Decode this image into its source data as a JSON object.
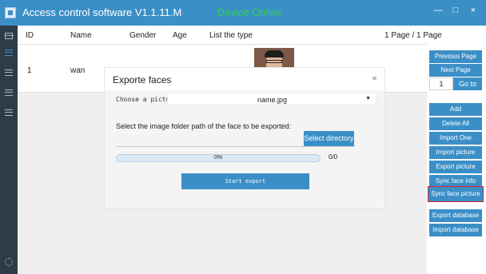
{
  "window": {
    "title": "Access control software V1.1.11.M",
    "device_status": "Device Online",
    "minimize": "—",
    "maximize": "□",
    "close": "×"
  },
  "sidebar": {
    "icons": [
      "list-icon",
      "menu-icon",
      "menu-icon",
      "menu-icon",
      "menu-icon"
    ],
    "settings_icon": "gear-icon"
  },
  "table": {
    "columns": [
      "ID",
      "Name",
      "Gender",
      "Age",
      "List the type"
    ],
    "page_info": "1 Page / 1 Page",
    "rows": [
      {
        "id": "1",
        "name": "wan"
      }
    ]
  },
  "right_panel": {
    "previous_page": "Previous Page",
    "next_page": "Next Page",
    "page_input": "1",
    "go_to": "Go to",
    "add": "Add",
    "delete_all": "Delete All",
    "import_one": "Import One",
    "import_picture": "Import picture",
    "export_picture": "Export picture",
    "sync_face_info": "Sync face info",
    "sync_face_picture": "Sync face picture",
    "export_database": "Export database",
    "import_database": "Import database"
  },
  "dialog": {
    "title": "Exporte faces",
    "close": "×",
    "choose_label": "Choose a picture",
    "choose_value": "name.jpg",
    "folder_label": "Select the image folder path of the face to be exported:",
    "select_directory": "Select directory",
    "progress_text": "0%",
    "progress_value": 0,
    "count": "0/0",
    "start_export": "Start export"
  },
  "colors": {
    "accent": "#3b8fc7",
    "sidebar": "#2e3c49",
    "status_online": "#2dd14a",
    "highlight_border": "#e0202a"
  }
}
